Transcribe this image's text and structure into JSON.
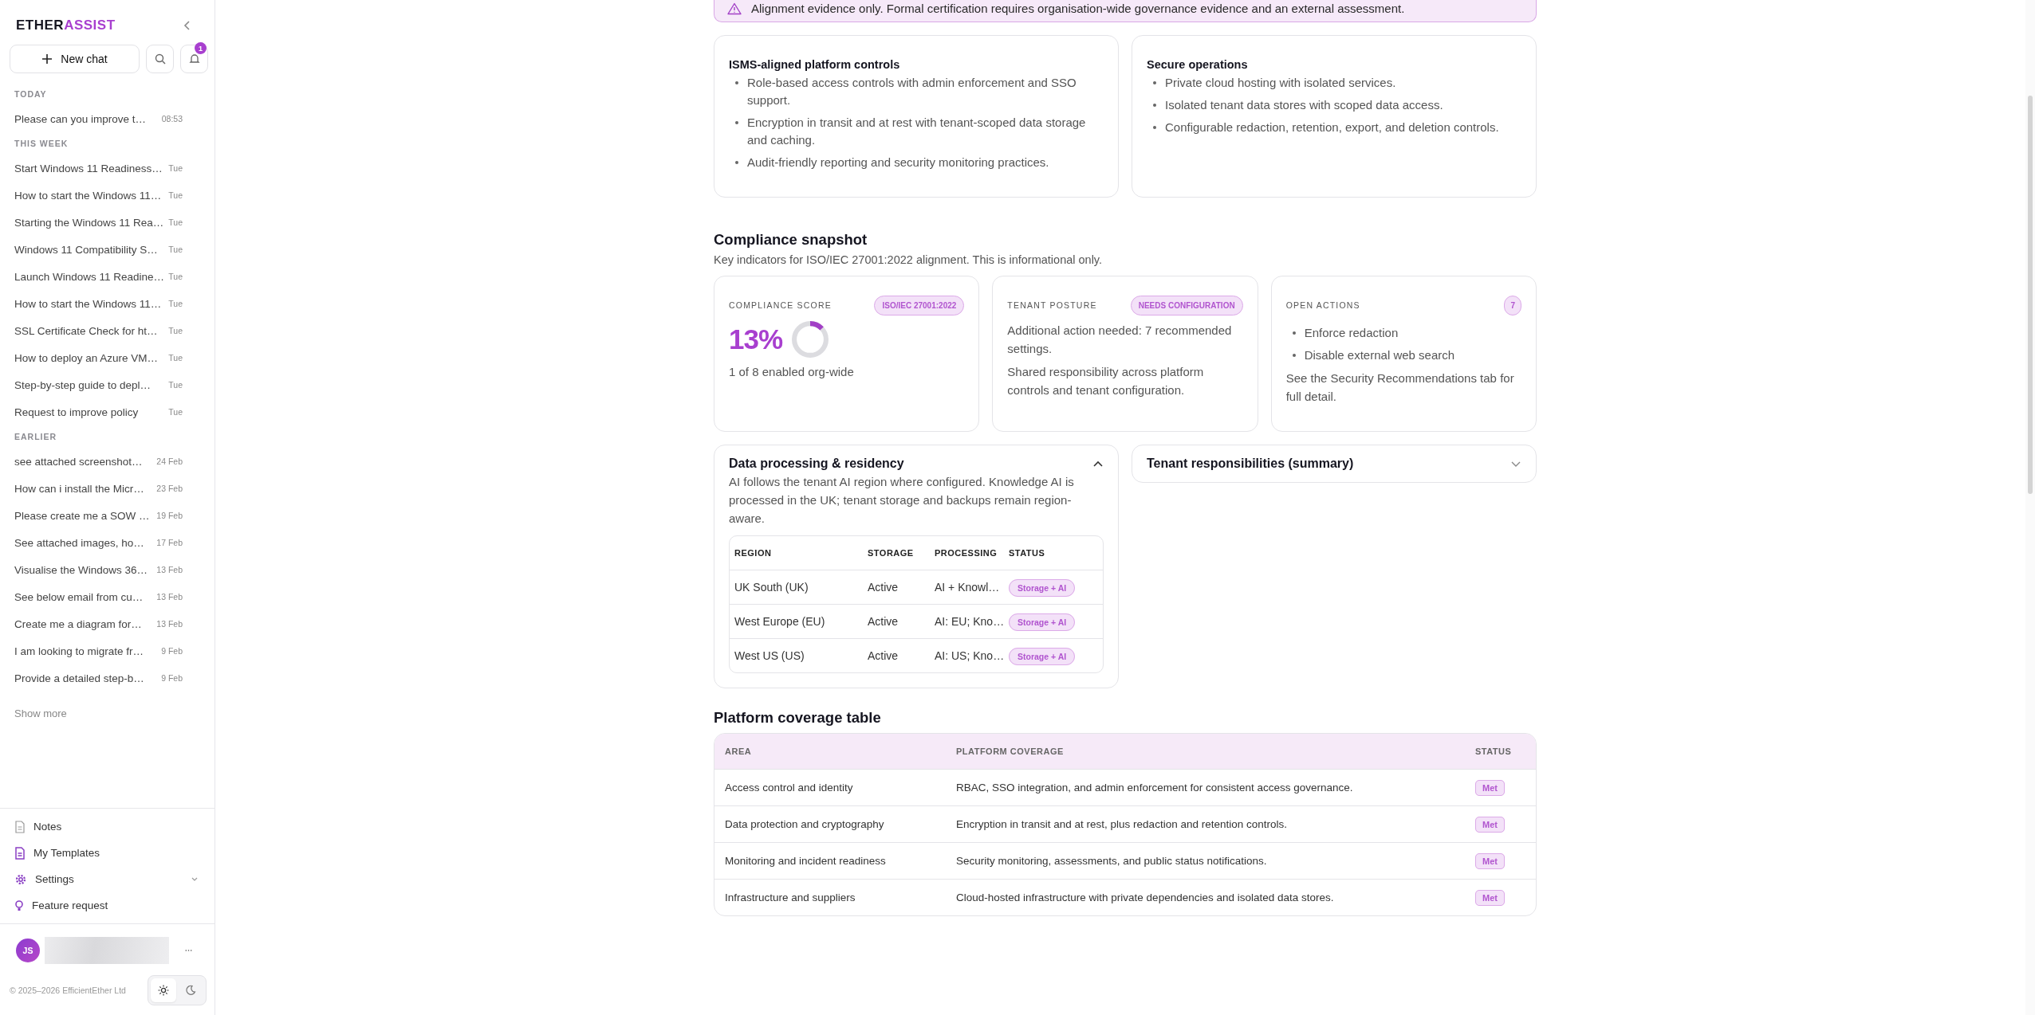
{
  "sidebar": {
    "logo": {
      "part_1": "ETHER",
      "part_2": "ASSIST"
    },
    "new_chat": "New chat",
    "notifications": {
      "badge": "1"
    },
    "sections": [
      {
        "label": "TODAY",
        "chats": [
          {
            "title": "Please can you improve t…",
            "time": "08:53"
          }
        ]
      },
      {
        "label": "THIS WEEK",
        "chats": [
          {
            "title": "Start Windows 11 Readiness…",
            "time": "Tue"
          },
          {
            "title": "How to start the Windows 11…",
            "time": "Tue"
          },
          {
            "title": "Starting the Windows 11 Rea…",
            "time": "Tue"
          },
          {
            "title": "Windows 11 Compatibility S…",
            "time": "Tue"
          },
          {
            "title": "Launch Windows 11 Readine…",
            "time": "Tue"
          },
          {
            "title": "How to start the Windows 11…",
            "time": "Tue"
          },
          {
            "title": "SSL Certificate Check for ht…",
            "time": "Tue"
          },
          {
            "title": "How to deploy an Azure VM…",
            "time": "Tue"
          },
          {
            "title": "Step-by-step guide to depl…",
            "time": "Tue"
          },
          {
            "title": "Request to improve policy",
            "time": "Tue"
          }
        ]
      },
      {
        "label": "EARLIER",
        "chats": [
          {
            "title": "see attached screenshot…",
            "time": "24 Feb"
          },
          {
            "title": "How can i install the Micr…",
            "time": "23 Feb"
          },
          {
            "title": "Please create me a SOW …",
            "time": "19 Feb"
          },
          {
            "title": "See attached images, ho…",
            "time": "17 Feb"
          },
          {
            "title": "Visualise the Windows 36…",
            "time": "13 Feb"
          },
          {
            "title": "See below email from cu…",
            "time": "13 Feb"
          },
          {
            "title": "Create me a diagram for…",
            "time": "13 Feb"
          },
          {
            "title": "I am looking to migrate fr…",
            "time": "9 Feb"
          },
          {
            "title": "Provide a detailed step-b…",
            "time": "9 Feb"
          }
        ]
      }
    ],
    "show_more": "Show more",
    "nav": [
      {
        "kind": "notes",
        "label": "Notes"
      },
      {
        "kind": "templates",
        "label": "My Templates"
      },
      {
        "kind": "settings",
        "label": "Settings",
        "expanded": false
      },
      {
        "kind": "feature",
        "label": "Feature request"
      }
    ],
    "user": {
      "initials": "JS"
    },
    "copyright": "© 2025–2026 EfficientEther Ltd",
    "theme": [
      {
        "kind": "light",
        "selected": true
      },
      {
        "kind": "dark",
        "selected": false
      }
    ]
  },
  "notice": "Alignment evidence only. Formal certification requires organisation-wide governance evidence and an external assessment.",
  "feature_cards": [
    {
      "title": "ISMS-aligned platform controls",
      "items": [
        "Role-based access controls with admin enforcement and SSO support.",
        "Encryption in transit and at rest with tenant-scoped data storage and caching.",
        "Audit-friendly reporting and security monitoring practices."
      ]
    },
    {
      "title": "Secure operations",
      "items": [
        "Private cloud hosting with isolated services.",
        "Isolated tenant data stores with scoped data access.",
        "Configurable redaction, retention, export, and deletion controls."
      ]
    }
  ],
  "snapshot": {
    "title": "Compliance snapshot",
    "subtitle": "Key indicators for ISO/IEC 27001:2022 alignment. This is informational only.",
    "score": {
      "label": "COMPLIANCE SCORE",
      "badge": "ISO/IEC 27001:2022",
      "value": "13%",
      "caption": "1 of 8 enabled org-wide"
    },
    "posture": {
      "label": "TENANT POSTURE",
      "badge": "NEEDS CONFIGURATION",
      "paragraphs": [
        "Additional action needed: 7 recommended settings.",
        "Shared responsibility across platform controls and tenant configuration."
      ]
    },
    "actions": {
      "label": "OPEN ACTIONS",
      "badge": "7",
      "items": [
        "Enforce redaction",
        "Disable external web search"
      ],
      "note": "See the Security Recommendations tab for full detail."
    }
  },
  "residency": {
    "title": "Data processing & residency",
    "expanded": true,
    "description": "AI follows the tenant AI region where configured. Knowledge AI is processed in the UK; tenant storage and backups remain region-aware.",
    "columns": [
      "REGION",
      "STORAGE",
      "PROCESSING",
      "STATUS"
    ],
    "rows": [
      {
        "region": "UK South (UK)",
        "storage": "Active",
        "processing": "AI + Knowl…",
        "status": "Storage + AI"
      },
      {
        "region": "West Europe (EU)",
        "storage": "Active",
        "processing": "AI: EU; Kno…",
        "status": "Storage + AI"
      },
      {
        "region": "West US (US)",
        "storage": "Active",
        "processing": "AI: US; Kno…",
        "status": "Storage + AI"
      }
    ]
  },
  "responsibilities": {
    "title": "Tenant responsibilities (summary)",
    "expanded": false
  },
  "coverage": {
    "title": "Platform coverage table",
    "columns": [
      "AREA",
      "PLATFORM COVERAGE",
      "STATUS"
    ],
    "rows": [
      {
        "area": "Access control and identity",
        "coverage": "RBAC, SSO integration, and admin enforcement for consistent access governance.",
        "status": "Met"
      },
      {
        "area": "Data protection and cryptography",
        "coverage": "Encryption in transit and at rest, plus redaction and retention controls.",
        "status": "Met"
      },
      {
        "area": "Monitoring and incident readiness",
        "coverage": "Security monitoring, assessments, and public status notifications.",
        "status": "Met"
      },
      {
        "area": "Infrastructure and suppliers",
        "coverage": "Cloud-hosted infrastructure with private dependencies and isolated data stores.",
        "status": "Met"
      }
    ]
  }
}
